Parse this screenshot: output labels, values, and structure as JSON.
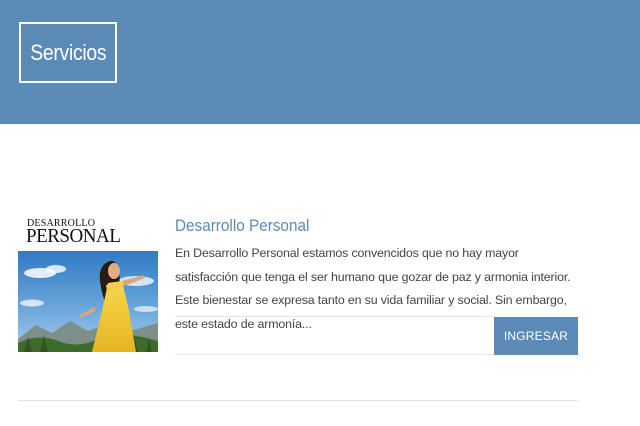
{
  "header": {
    "title": "Servicios",
    "background_color": "#5b8ab6"
  },
  "service": {
    "image": {
      "logo_line1": "DESARROLLO",
      "logo_line2": "PERSONAL"
    },
    "title": "Desarrollo Personal",
    "description": "En Desarrollo Personal estamos convencidos que no hay mayor satisfacción que tenga el ser humano que gozar de paz y armonia interior. Este bienestar se expresa tanto en su vida familiar y social. Sin embargo, este estado de armonía...",
    "button_label": "INGRESAR",
    "accent_color": "#5b8ab6"
  }
}
